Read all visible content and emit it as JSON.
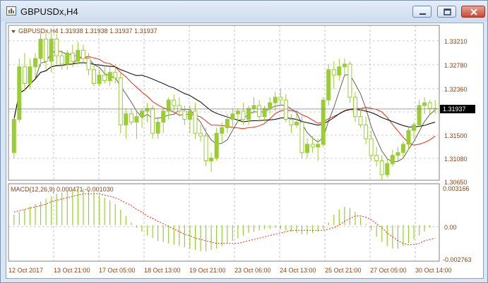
{
  "window": {
    "title": "GBPUSDx,H4"
  },
  "main_panel": {
    "header": "GBPUSDx,H4  1.31938 1.31938 1.31937 1.31937",
    "price_axis_labels": [
      "1.33210",
      "1.32780",
      "1.32360",
      "1.31500",
      "1.31080",
      "1.30650"
    ],
    "current_price_label": "1.31937",
    "current_price": 1.31937
  },
  "macd_panel": {
    "header": "MACD(12,26,9) 0.000471 -0.001030",
    "axis_labels": [
      "0.003166",
      "0.00",
      "-0.002763"
    ]
  },
  "time_axis_labels": [
    "12 Oct 2017",
    "13 Oct 21:00",
    "17 Oct 05:00",
    "18 Oct 13:00",
    "19 Oct 21:00",
    "23 Oct 06:00",
    "24 Oct 13:00",
    "25 Oct 21:00",
    "27 Oct 05:00",
    "30 Oct 14:00"
  ],
  "colors": {
    "bull_candle": "#9acd32",
    "bear_candle": "#ffffff",
    "ma_fast": "#606060",
    "ma_mid": "#e03010",
    "ma_slow": "#000000",
    "macd_histogram": "#9acd32",
    "macd_signal": "#e03010",
    "axis_text": "#8b4513",
    "grid": "#a0a0a0",
    "window_close": "#c74a36"
  },
  "chart_data": [
    {
      "type": "candlestick",
      "symbol": "GBPUSDx",
      "timeframe": "H4",
      "ylim": [
        1.3065,
        1.3345
      ],
      "candles_ohlc": [
        [
          1.3115,
          1.318,
          1.3105,
          1.3175
        ],
        [
          1.3175,
          1.3285,
          1.317,
          1.327
        ],
        [
          1.327,
          1.3295,
          1.3225,
          1.324
        ],
        [
          1.324,
          1.3285,
          1.323,
          1.327
        ],
        [
          1.327,
          1.3295,
          1.325,
          1.3285
        ],
        [
          1.3285,
          1.333,
          1.327,
          1.332
        ],
        [
          1.332,
          1.333,
          1.3265,
          1.328
        ],
        [
          1.328,
          1.333,
          1.326,
          1.332
        ],
        [
          1.332,
          1.333,
          1.3275,
          1.329
        ],
        [
          1.329,
          1.33,
          1.3265,
          1.3275
        ],
        [
          1.3275,
          1.33,
          1.3265,
          1.3295
        ],
        [
          1.3295,
          1.331,
          1.327,
          1.328
        ],
        [
          1.328,
          1.3315,
          1.3275,
          1.33
        ],
        [
          1.33,
          1.331,
          1.3275,
          1.3285
        ],
        [
          1.3285,
          1.3295,
          1.3255,
          1.3265
        ],
        [
          1.3265,
          1.3275,
          1.3235,
          1.324
        ],
        [
          1.324,
          1.3265,
          1.3235,
          1.3255
        ],
        [
          1.3255,
          1.327,
          1.324,
          1.3245
        ],
        [
          1.3245,
          1.327,
          1.3235,
          1.326
        ],
        [
          1.326,
          1.3275,
          1.324,
          1.325
        ],
        [
          1.325,
          1.326,
          1.315,
          1.3165
        ],
        [
          1.3165,
          1.3195,
          1.314,
          1.3185
        ],
        [
          1.3185,
          1.3195,
          1.3165,
          1.317
        ],
        [
          1.317,
          1.319,
          1.314,
          1.318
        ],
        [
          1.318,
          1.3195,
          1.316,
          1.319
        ],
        [
          1.319,
          1.3205,
          1.317,
          1.3195
        ],
        [
          1.3195,
          1.32,
          1.314,
          1.315
        ],
        [
          1.315,
          1.318,
          1.314,
          1.317
        ],
        [
          1.317,
          1.3195,
          1.315,
          1.319
        ],
        [
          1.319,
          1.3215,
          1.3175,
          1.321
        ],
        [
          1.321,
          1.322,
          1.319,
          1.32
        ],
        [
          1.32,
          1.3215,
          1.318,
          1.319
        ],
        [
          1.319,
          1.32,
          1.3165,
          1.3175
        ],
        [
          1.3175,
          1.32,
          1.315,
          1.319
        ],
        [
          1.319,
          1.3205,
          1.314,
          1.315
        ],
        [
          1.315,
          1.3165,
          1.3135,
          1.3145
        ],
        [
          1.3145,
          1.316,
          1.309,
          1.31
        ],
        [
          1.31,
          1.3115,
          1.308,
          1.3105
        ],
        [
          1.3105,
          1.316,
          1.31,
          1.315
        ],
        [
          1.315,
          1.317,
          1.3135,
          1.316
        ],
        [
          1.316,
          1.3185,
          1.315,
          1.3175
        ],
        [
          1.3175,
          1.3195,
          1.316,
          1.3185
        ],
        [
          1.3185,
          1.3195,
          1.317,
          1.319
        ],
        [
          1.319,
          1.3205,
          1.3165,
          1.3175
        ],
        [
          1.3175,
          1.32,
          1.3165,
          1.3195
        ],
        [
          1.3195,
          1.3215,
          1.3185,
          1.32
        ],
        [
          1.32,
          1.321,
          1.317,
          1.318
        ],
        [
          1.318,
          1.32,
          1.317,
          1.3195
        ],
        [
          1.3195,
          1.3215,
          1.3185,
          1.3205
        ],
        [
          1.3205,
          1.3225,
          1.319,
          1.3215
        ],
        [
          1.3215,
          1.323,
          1.32,
          1.321
        ],
        [
          1.321,
          1.322,
          1.317,
          1.3175
        ],
        [
          1.3175,
          1.3185,
          1.315,
          1.3165
        ],
        [
          1.3165,
          1.3185,
          1.316,
          1.317
        ],
        [
          1.317,
          1.318,
          1.3105,
          1.3115
        ],
        [
          1.3115,
          1.314,
          1.3105,
          1.313
        ],
        [
          1.313,
          1.3145,
          1.3115,
          1.3125
        ],
        [
          1.3125,
          1.314,
          1.31,
          1.313
        ],
        [
          1.313,
          1.3215,
          1.3125,
          1.321
        ],
        [
          1.321,
          1.3275,
          1.32,
          1.3265
        ],
        [
          1.3265,
          1.328,
          1.323,
          1.3255
        ],
        [
          1.3255,
          1.3285,
          1.3245,
          1.327
        ],
        [
          1.327,
          1.3285,
          1.3255,
          1.3275
        ],
        [
          1.3275,
          1.328,
          1.3205,
          1.3215
        ],
        [
          1.3215,
          1.3225,
          1.317,
          1.318
        ],
        [
          1.318,
          1.3195,
          1.316,
          1.3165
        ],
        [
          1.3165,
          1.318,
          1.313,
          1.314
        ],
        [
          1.314,
          1.3155,
          1.31,
          1.311
        ],
        [
          1.311,
          1.3125,
          1.309,
          1.31
        ],
        [
          1.31,
          1.311,
          1.3065,
          1.3075
        ],
        [
          1.3075,
          1.3105,
          1.307,
          1.3095
        ],
        [
          1.3095,
          1.312,
          1.309,
          1.311
        ],
        [
          1.311,
          1.3125,
          1.31,
          1.3115
        ],
        [
          1.3115,
          1.3135,
          1.3105,
          1.313
        ],
        [
          1.313,
          1.316,
          1.312,
          1.3155
        ],
        [
          1.3155,
          1.317,
          1.314,
          1.3165
        ],
        [
          1.3165,
          1.321,
          1.316,
          1.32
        ],
        [
          1.32,
          1.3215,
          1.3185,
          1.3205
        ],
        [
          1.3205,
          1.321,
          1.3185,
          1.3195
        ],
        [
          1.3195,
          1.321,
          1.3185,
          1.3194
        ]
      ]
    },
    {
      "type": "bar",
      "name": "MACD(12,26,9)",
      "ylim": [
        -0.002763,
        0.003166
      ],
      "histogram": [
        0.0008,
        0.001,
        0.0012,
        0.0014,
        0.0016,
        0.0018,
        0.002,
        0.0022,
        0.0024,
        0.0025,
        0.0026,
        0.0027,
        0.0028,
        0.0028,
        0.0027,
        0.0025,
        0.0023,
        0.0021,
        0.0019,
        0.0016,
        0.0012,
        0.0007,
        0.0002,
        -0.0002,
        -0.0005,
        -0.0008,
        -0.001,
        -0.0012,
        -0.0013,
        -0.0014,
        -0.0015,
        -0.0016,
        -0.0017,
        -0.0018,
        -0.0019,
        -0.002,
        -0.002,
        -0.0019,
        -0.0018,
        -0.0016,
        -0.0014,
        -0.0012,
        -0.001,
        -0.0008,
        -0.0006,
        -0.0005,
        -0.0004,
        -0.0003,
        -0.0003,
        -0.0002,
        -0.0003,
        -0.0004,
        -0.0005,
        -0.0006,
        -0.0007,
        -0.0007,
        -0.0006,
        -0.0005,
        -0.0003,
        0.0002,
        0.0008,
        0.0012,
        0.0014,
        0.0013,
        0.001,
        0.0006,
        0.0001,
        -0.0004,
        -0.0009,
        -0.0013,
        -0.0016,
        -0.0018,
        -0.0018,
        -0.0016,
        -0.0014,
        -0.0011,
        -0.0008,
        -0.0005,
        -0.0002,
        0.0
      ],
      "signal": [
        0.001,
        0.0011,
        0.0012,
        0.0013,
        0.0014,
        0.0015,
        0.0016,
        0.0018,
        0.0019,
        0.002,
        0.0021,
        0.0022,
        0.0023,
        0.0024,
        0.0024,
        0.0024,
        0.0024,
        0.0023,
        0.0022,
        0.0021,
        0.0019,
        0.0017,
        0.0015,
        0.0012,
        0.001,
        0.0007,
        0.0005,
        0.0003,
        0.0001,
        -0.0001,
        -0.0003,
        -0.0005,
        -0.0007,
        -0.0008,
        -0.001,
        -0.0011,
        -0.0012,
        -0.0013,
        -0.0014,
        -0.0014,
        -0.0014,
        -0.0014,
        -0.0014,
        -0.0013,
        -0.0012,
        -0.0011,
        -0.001,
        -0.0009,
        -0.0008,
        -0.0007,
        -0.0006,
        -0.0005,
        -0.0004,
        -0.0004,
        -0.0004,
        -0.0004,
        -0.0004,
        -0.0004,
        -0.0004,
        -0.0003,
        -0.0002,
        0.0,
        0.0003,
        0.0005,
        0.0007,
        0.0007,
        0.0006,
        0.0004,
        0.0001,
        -0.0002,
        -0.0006,
        -0.0009,
        -0.0012,
        -0.0014,
        -0.0015,
        -0.0015,
        -0.0014,
        -0.0012,
        -0.0011,
        -0.001
      ]
    }
  ]
}
